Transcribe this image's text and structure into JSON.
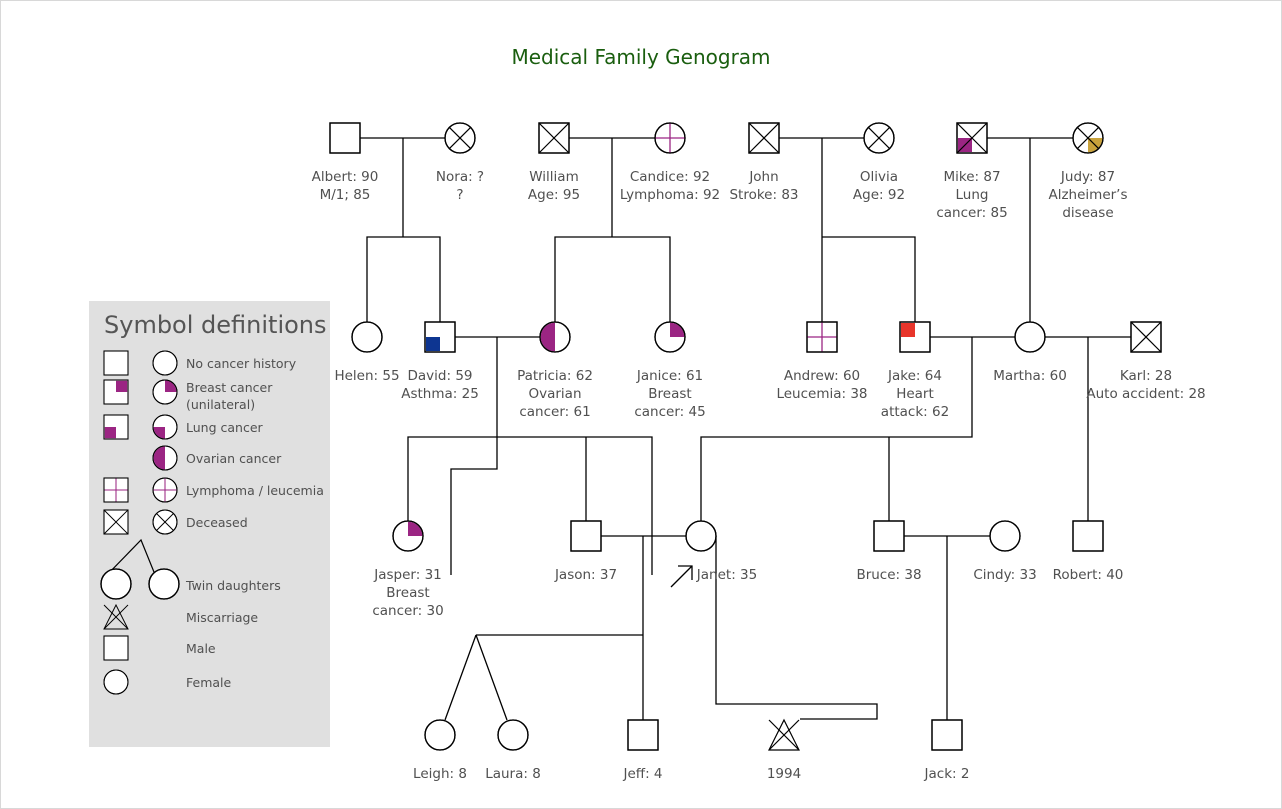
{
  "title": "Medical Family Genogram",
  "colors": {
    "title": "#1a5e0f",
    "cancer": "#9b2583",
    "asthma": "#0d3591",
    "heart": "#e8352b",
    "alzheimer": "#c9a23b",
    "legend_bg": "#e0e0e0",
    "line": "#000000",
    "text": "#505050"
  },
  "legend": {
    "title": "Symbol definitions",
    "items": [
      {
        "label": "No cancer history",
        "symbols": [
          "male",
          "female"
        ]
      },
      {
        "label": "Breast cancer",
        "label2": "(unilateral)",
        "symbols": [
          "male-breast",
          "female-breast"
        ]
      },
      {
        "label": "Lung cancer",
        "symbols": [
          "male-lung",
          "female-lung"
        ]
      },
      {
        "label": "Ovarian cancer",
        "symbols": [
          "female-ovarian"
        ]
      },
      {
        "label": "Lymphoma / leucemia",
        "symbols": [
          "male-lymphoma",
          "female-lymphoma"
        ]
      },
      {
        "label": "Deceased",
        "symbols": [
          "male-deceased",
          "female-deceased"
        ]
      },
      {
        "label": "Twin daughters",
        "symbols": [
          "twins"
        ]
      },
      {
        "label": "Miscarriage",
        "symbols": [
          "miscarriage"
        ]
      },
      {
        "label": "Male",
        "symbols": [
          "male"
        ]
      },
      {
        "label": "Female",
        "symbols": [
          "female"
        ]
      }
    ]
  },
  "people": [
    {
      "id": "albert",
      "sex": "male",
      "lines": [
        "Albert: 90",
        "M/1; 85"
      ]
    },
    {
      "id": "nora",
      "sex": "female",
      "deceased": true,
      "lines": [
        "Nora: ?",
        "?"
      ]
    },
    {
      "id": "william",
      "sex": "male",
      "deceased": true,
      "lines": [
        "William",
        "Age: 95"
      ]
    },
    {
      "id": "candice",
      "sex": "female",
      "condition": "lymphoma",
      "lines": [
        "Candice: 92",
        "Lymphoma: 92"
      ]
    },
    {
      "id": "john",
      "sex": "male",
      "deceased": true,
      "lines": [
        "John",
        "Stroke: 83"
      ]
    },
    {
      "id": "olivia",
      "sex": "female",
      "deceased": true,
      "lines": [
        "Olivia",
        "Age: 92"
      ]
    },
    {
      "id": "mike",
      "sex": "male",
      "deceased": true,
      "condition": "lung",
      "lines": [
        "Mike: 87",
        "Lung",
        "cancer: 85"
      ]
    },
    {
      "id": "judy",
      "sex": "female",
      "deceased": true,
      "condition": "alzheimer",
      "lines": [
        "Judy: 87",
        "Alzheimer’s",
        "disease"
      ]
    },
    {
      "id": "helen",
      "sex": "female",
      "lines": [
        "Helen: 55"
      ]
    },
    {
      "id": "david",
      "sex": "male",
      "condition": "asthma",
      "lines": [
        "David: 59",
        "Asthma: 25"
      ]
    },
    {
      "id": "patricia",
      "sex": "female",
      "condition": "ovarian",
      "lines": [
        "Patricia: 62",
        "Ovarian",
        "cancer: 61"
      ]
    },
    {
      "id": "janice",
      "sex": "female",
      "condition": "breast",
      "lines": [
        "Janice: 61",
        "Breast",
        "cancer: 45"
      ]
    },
    {
      "id": "andrew",
      "sex": "male",
      "condition": "leucemia",
      "lines": [
        "Andrew: 60",
        "Leucemia: 38"
      ]
    },
    {
      "id": "jake",
      "sex": "male",
      "condition": "heart",
      "lines": [
        "Jake: 64",
        "Heart",
        "attack: 62"
      ]
    },
    {
      "id": "martha",
      "sex": "female",
      "lines": [
        "Martha: 60"
      ]
    },
    {
      "id": "karl",
      "sex": "male",
      "deceased": true,
      "lines": [
        "Karl: 28",
        "Auto accident: 28"
      ]
    },
    {
      "id": "jasper",
      "sex": "female",
      "condition": "breast",
      "lines": [
        "Jasper: 31",
        "Breast",
        "cancer: 30"
      ]
    },
    {
      "id": "jason",
      "sex": "male",
      "lines": [
        "Jason: 37"
      ]
    },
    {
      "id": "janet",
      "sex": "female",
      "proband": true,
      "lines": [
        "Janet: 35"
      ]
    },
    {
      "id": "bruce",
      "sex": "male",
      "lines": [
        "Bruce: 38"
      ]
    },
    {
      "id": "cindy",
      "sex": "female",
      "lines": [
        "Cindy: 33"
      ]
    },
    {
      "id": "robert",
      "sex": "male",
      "lines": [
        "Robert: 40"
      ]
    },
    {
      "id": "leigh",
      "sex": "female",
      "twin": true,
      "lines": [
        "Leigh: 8"
      ]
    },
    {
      "id": "laura",
      "sex": "female",
      "twin": true,
      "lines": [
        "Laura: 8"
      ]
    },
    {
      "id": "jeff",
      "sex": "male",
      "lines": [
        "Jeff: 4"
      ]
    },
    {
      "id": "miscarriage",
      "sex": "miscarriage",
      "lines": [
        "1994"
      ]
    },
    {
      "id": "jack",
      "sex": "male",
      "lines": [
        "Jack: 2"
      ]
    }
  ]
}
